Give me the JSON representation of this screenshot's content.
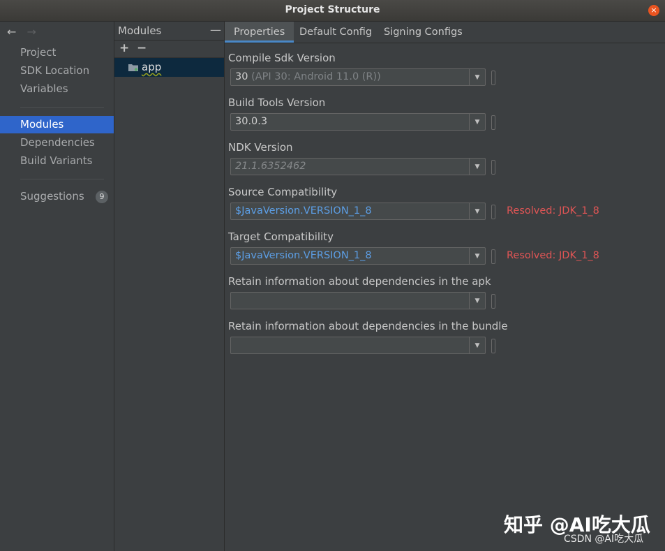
{
  "window": {
    "title": "Project Structure",
    "close_glyph": "×"
  },
  "nav": {
    "back": "←",
    "forward": "→"
  },
  "sidebar": {
    "items": [
      {
        "label": "Project"
      },
      {
        "label": "SDK Location"
      },
      {
        "label": "Variables"
      },
      {
        "label": "Modules"
      },
      {
        "label": "Dependencies"
      },
      {
        "label": "Build Variants"
      },
      {
        "label": "Suggestions",
        "badge": "9"
      }
    ],
    "selected": "Modules"
  },
  "modules_panel": {
    "header": "Modules",
    "collapse_glyph": "—",
    "add_glyph": "+",
    "remove_glyph": "−",
    "items": [
      {
        "name": "app"
      }
    ]
  },
  "tabs": [
    {
      "label": "Properties",
      "active": true
    },
    {
      "label": "Default Config"
    },
    {
      "label": "Signing Configs"
    }
  ],
  "properties": {
    "compile_sdk": {
      "label": "Compile Sdk Version",
      "value": "30",
      "hint": "(API 30: Android 11.0 (R))"
    },
    "build_tools": {
      "label": "Build Tools Version",
      "value": "30.0.3"
    },
    "ndk": {
      "label": "NDK Version",
      "value": "21.1.6352462"
    },
    "source_compat": {
      "label": "Source Compatibility",
      "value": "$JavaVersion.VERSION_1_8",
      "resolved": "Resolved: JDK_1_8"
    },
    "target_compat": {
      "label": "Target Compatibility",
      "value": "$JavaVersion.VERSION_1_8",
      "resolved": "Resolved: JDK_1_8"
    },
    "retain_apk": {
      "label": "Retain information about dependencies in the apk",
      "value": ""
    },
    "retain_bundle": {
      "label": "Retain information about dependencies in the bundle",
      "value": ""
    }
  },
  "combo_arrow_glyph": "▼",
  "watermark": {
    "line1": "知乎 @AI吃大瓜",
    "line2": "CSDN @AI吃大瓜"
  },
  "colors": {
    "selection": "#2f65ca",
    "link": "#5c9ee5",
    "error": "#e05555",
    "close": "#e95420"
  }
}
